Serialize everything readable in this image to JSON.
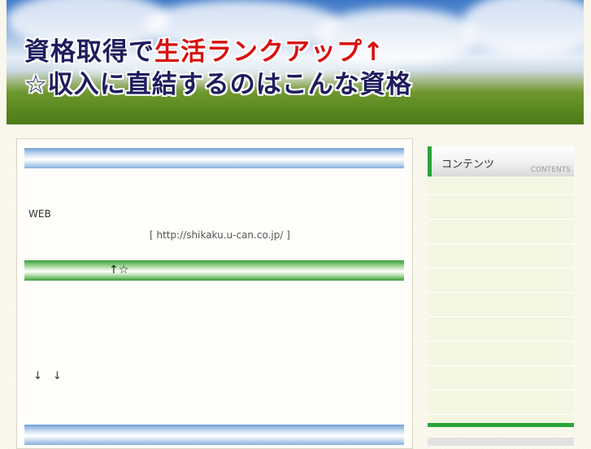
{
  "header": {
    "line1_prefix": "資格取得で",
    "line1_highlight": "生活ランクアップ",
    "line1_arrow": "↑",
    "line2": "☆収入に直結するのはこんな資格"
  },
  "main": {
    "web_text": "WEB",
    "url_text": "[ http://shikaku.u-can.co.jp/ ]",
    "green_bar_text": "↑☆",
    "arrows_text": "↓　↓"
  },
  "sidebar": {
    "title": "コンテンツ",
    "subtitle": "CONTENTS"
  }
}
